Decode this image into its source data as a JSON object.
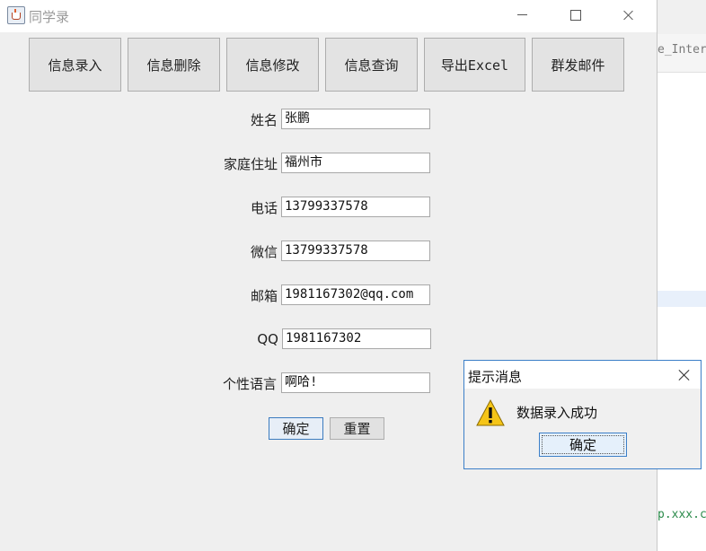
{
  "window": {
    "title": "同学录"
  },
  "nav_buttons": [
    {
      "label": "信息录入"
    },
    {
      "label": "信息删除"
    },
    {
      "label": "信息修改"
    },
    {
      "label": "信息查询"
    },
    {
      "label": "导出Excel"
    },
    {
      "label": "群发邮件"
    }
  ],
  "form": {
    "name": {
      "label": "姓名",
      "value": "张鹏"
    },
    "address": {
      "label": "家庭住址",
      "value": "福州市"
    },
    "phone": {
      "label": "电话",
      "value": "13799337578"
    },
    "wechat": {
      "label": "微信",
      "value": "13799337578"
    },
    "email": {
      "label": "邮箱",
      "value": "1981167302@qq.com"
    },
    "qq": {
      "label": "QQ",
      "value": "1981167302"
    },
    "motto": {
      "label": "个性语言",
      "value": "啊哈!"
    }
  },
  "actions": {
    "confirm_label": "确定",
    "reset_label": "重置"
  },
  "dialog": {
    "title": "提示消息",
    "message": "数据录入成功",
    "ok_label": "确定",
    "icon": "warning-icon"
  },
  "background_ide": {
    "line1": "e_Interf",
    "line2": "p.xxx.c"
  }
}
